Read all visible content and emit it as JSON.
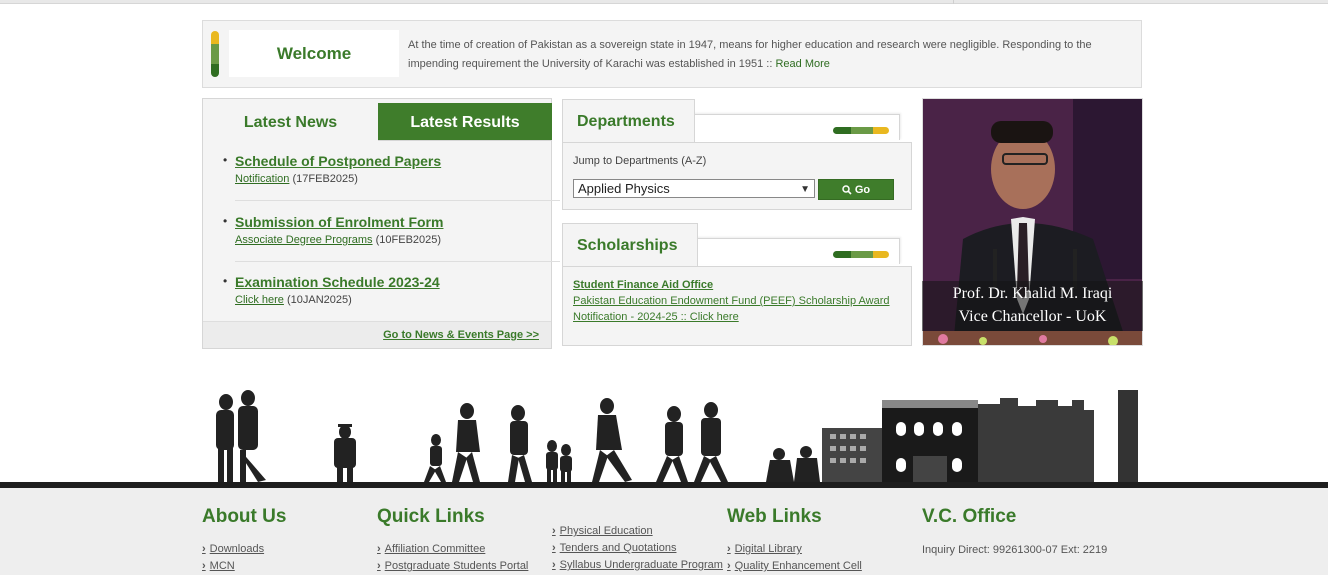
{
  "welcome": {
    "title": "Welcome",
    "text": "At the time of creation of Pakistan as a sovereign state in 1947, means for higher education and research were negligible. Responding to the impending requirement the University of Karachi was established in 1951 :: ",
    "read_more": "Read More"
  },
  "news": {
    "tab_news": "Latest News",
    "tab_results": "Latest Results",
    "items": [
      {
        "title": "Schedule of Postponed Papers",
        "link": "Notification",
        "date": "(17FEB2025)"
      },
      {
        "title": "Submission of Enrolment Form",
        "link": "Associate Degree Programs",
        "date": "(10FEB2025)"
      },
      {
        "title": "Examination Schedule 2023-24",
        "link": "Click here",
        "date": "(10JAN2025)"
      }
    ],
    "footer_link": "Go to News & Events Page >>"
  },
  "departments": {
    "title": "Departments",
    "label": "Jump to Departments (A-Z)",
    "selected": "Applied Physics",
    "go": "Go"
  },
  "scholarships": {
    "title": "Scholarships",
    "line1": "Student Finance Aid Office",
    "line2": "Pakistan Education Endowment Fund (PEEF) Scholarship Award",
    "line3": "Notification - 2024-25 :: Click here"
  },
  "vc": {
    "name": "Prof. Dr. Khalid M. Iraqi",
    "role": "Vice Chancellor - UoK"
  },
  "footer": {
    "about": {
      "title": "About Us",
      "links": [
        "Downloads",
        "MCN"
      ]
    },
    "quick": {
      "title": "Quick Links",
      "links": [
        "Affiliation Committee",
        "Postgraduate Students Portal"
      ]
    },
    "quick2": {
      "links": [
        "Physical Education",
        "Tenders and Quotations",
        "Syllabus Undergraduate Program"
      ]
    },
    "web": {
      "title": "Web Links",
      "links": [
        "Digital Library",
        "Quality Enhancement Cell"
      ]
    },
    "vc": {
      "title": "V.C. Office",
      "inquiry": "Inquiry Direct: 99261300-07 Ext: 2219"
    }
  },
  "colors": {
    "accent": "#3a7a2a",
    "accent_dark": "#2f6d21",
    "yellow": "#e9b820"
  },
  "icons": {
    "go": "search-icon",
    "select": "chevron-down-icon"
  }
}
